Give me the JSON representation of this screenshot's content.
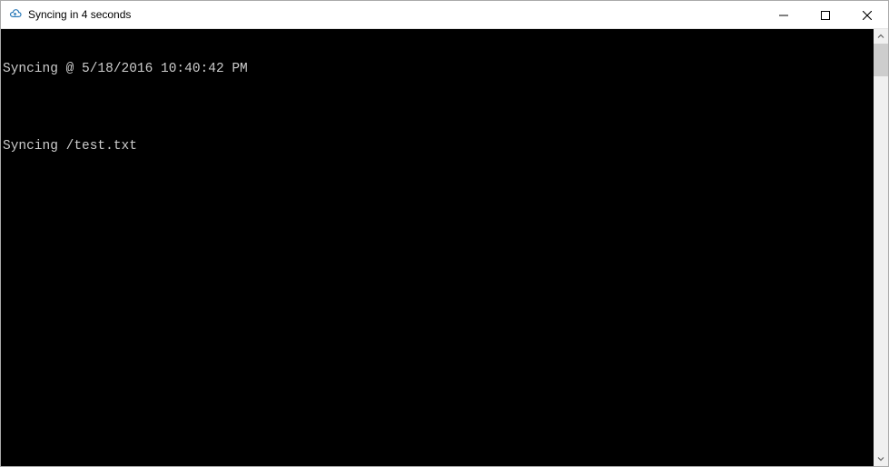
{
  "window": {
    "title": "Syncing in 4 seconds",
    "icon": "cloud-sync-icon",
    "controls": {
      "minimize": "Minimize",
      "maximize": "Maximize",
      "close": "Close"
    }
  },
  "console": {
    "lines": [
      "Syncing @ 5/18/2016 10:40:42 PM",
      "",
      "Syncing /test.txt"
    ]
  },
  "scrollbar": {
    "up": "Scroll up",
    "down": "Scroll down"
  }
}
